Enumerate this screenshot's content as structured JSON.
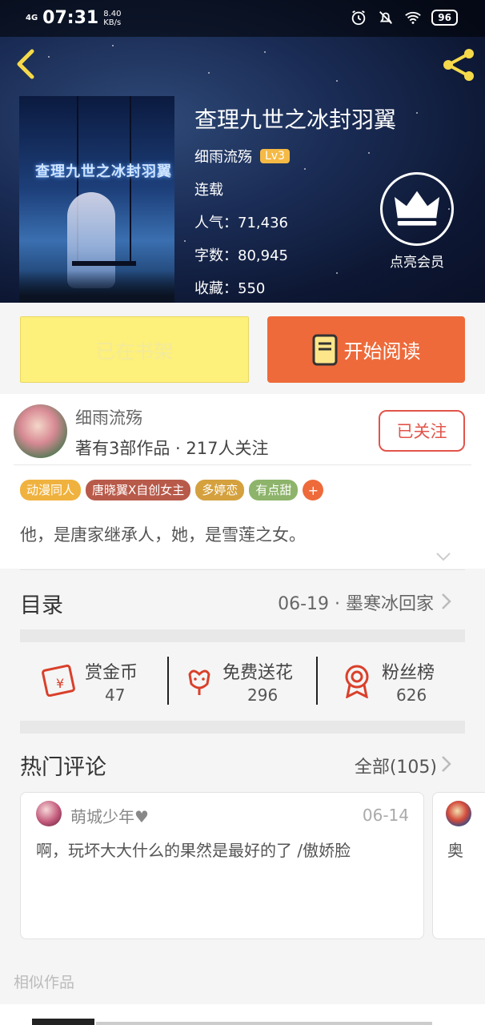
{
  "status_bar": {
    "signal": "4G",
    "time": "07:31",
    "speed_value": "8.40",
    "speed_unit": "KB/s",
    "battery": "96",
    "icons": [
      "alarm-icon",
      "mute-icon",
      "wifi-icon",
      "battery-icon"
    ]
  },
  "header": {
    "back_icon": "chevron-left-icon",
    "share_icon": "share-icon"
  },
  "book": {
    "title": "查理九世之冰封羽翼",
    "cover_art_title": "查理九世之冰封羽翼",
    "author": "细雨流殇",
    "level": "Lv3",
    "status": "连载",
    "popularity": "人气：71,436",
    "word_count": "字数：80,945",
    "favorites": "收藏：550"
  },
  "vip": {
    "label": "点亮会员",
    "icon": "crown-icon"
  },
  "actions": {
    "shelf_label": "已在书架",
    "read_label": "开始阅读",
    "read_icon": "book-icon"
  },
  "author_card": {
    "name": "细雨流殇",
    "stats": "著有3部作品 · 217人关注",
    "follow_label": "已关注"
  },
  "tags": [
    {
      "label": "动漫同人",
      "color": "#f0b23e"
    },
    {
      "label": "唐晓翼X自创女主",
      "color": "#b85a4a"
    },
    {
      "label": "多婷恋",
      "color": "#d4a13e"
    },
    {
      "label": "有点甜",
      "color": "#8db46a"
    }
  ],
  "tag_more": "+",
  "intro": "他，是唐家继承人，她，是雪莲之女。",
  "toc": {
    "label": "目录",
    "latest": "06-19 · 墨寒冰回家"
  },
  "stats": [
    {
      "label": "赏金币",
      "value": "47",
      "icon": "red-packet-icon"
    },
    {
      "label": "免费送花",
      "value": "296",
      "icon": "flower-icon"
    },
    {
      "label": "粉丝榜",
      "value": "626",
      "icon": "award-icon"
    }
  ],
  "comments_section": {
    "title": "热门评论",
    "all_label": "全部(105)"
  },
  "comments": [
    {
      "user": "萌城少年♥",
      "date": "06-14",
      "text": "啊，玩坏大大什么的果然是最好的了 /傲娇脸"
    },
    {
      "user": "",
      "date": "",
      "text": "奥"
    }
  ],
  "similar_title": "相似作品",
  "colors": {
    "accent_orange": "#ee6a3a",
    "shelf_yellow": "#fdf07b",
    "follow_red": "#e2544a",
    "level_badge": "#f5b945"
  }
}
